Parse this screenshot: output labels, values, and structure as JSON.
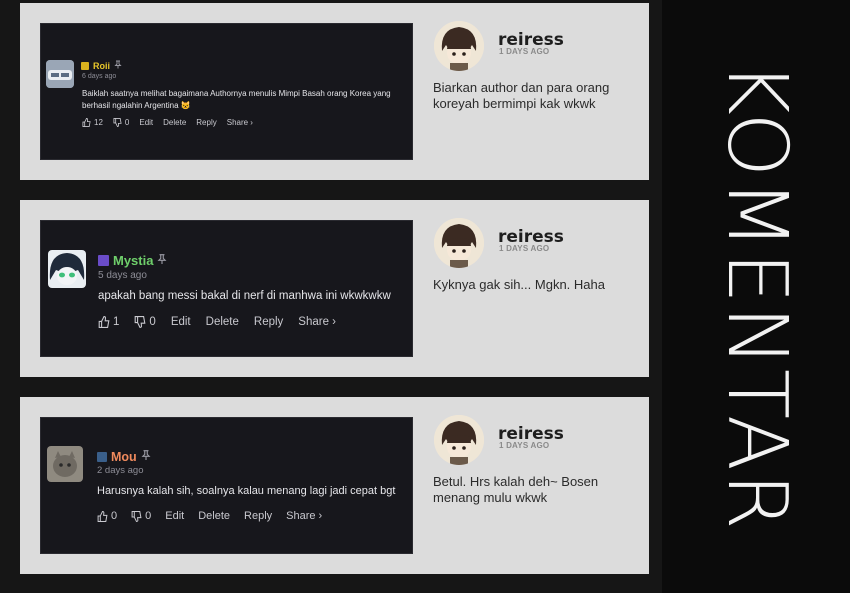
{
  "side_title": "KOMENTAR",
  "threads": [
    {
      "comment": {
        "username": "Roii",
        "time": "6 days ago",
        "text_lines": [
          "Baiklah saatnya melihat bagaimana Authornya menulis Mimpi Basah orang Korea yang",
          "berhasil ngalahin Argentina 😺"
        ],
        "likes": "12",
        "dislikes": "0",
        "edit": "Edit",
        "delete": "Delete",
        "reply": "Reply",
        "share": "Share ›",
        "name_color": "#e8c72a"
      },
      "reply": {
        "username": "reiress",
        "time": "1 DAYS AGO",
        "text": "Biarkan author dan para orang koreyah bermimpi kak wkwk"
      }
    },
    {
      "comment": {
        "username": "Mystia",
        "time": "5 days ago",
        "text_lines": [
          "apakah bang messi bakal di nerf di manhwa ini wkwkwkw"
        ],
        "likes": "1",
        "dislikes": "0",
        "edit": "Edit",
        "delete": "Delete",
        "reply": "Reply",
        "share": "Share ›",
        "name_color": "#6fcf6b"
      },
      "reply": {
        "username": "reiress",
        "time": "1 DAYS AGO",
        "text": "Kyknya gak sih... Mgkn. Haha"
      }
    },
    {
      "comment": {
        "username": "Mou",
        "time": "2 days ago",
        "text_lines": [
          "Harusnya kalah sih, soalnya kalau menang lagi jadi cepat bgt"
        ],
        "likes": "0",
        "dislikes": "0",
        "edit": "Edit",
        "delete": "Delete",
        "reply": "Reply",
        "share": "Share ›",
        "name_color": "#f08a5d"
      },
      "reply": {
        "username": "reiress",
        "time": "1 DAYS AGO",
        "text": "Betul. Hrs kalah deh~ Bosen menang mulu wkwk"
      }
    }
  ]
}
